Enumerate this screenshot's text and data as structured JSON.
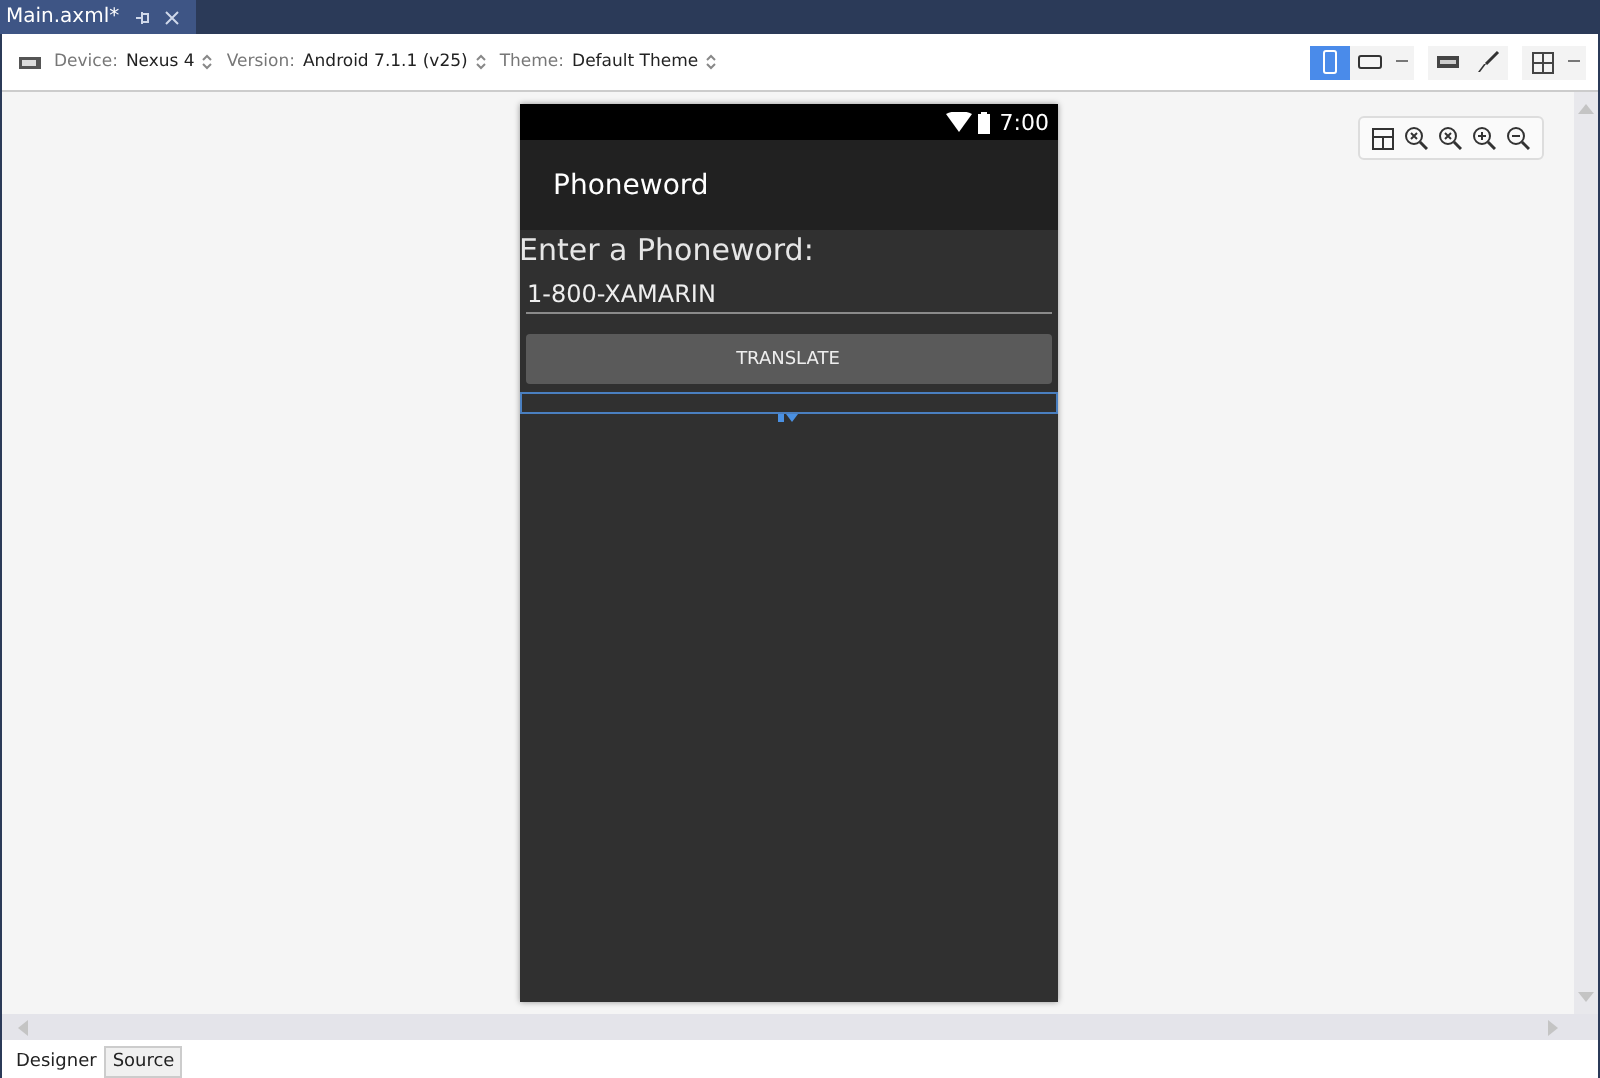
{
  "document_tabs": [
    {
      "label": "Main.axml*",
      "selected": true
    }
  ],
  "toolbar": {
    "fields": [
      {
        "label": "Device:",
        "value": "Nexus 4"
      },
      {
        "label": "Version:",
        "value": "Android 7.1.1 (v25)"
      },
      {
        "label": "Theme:",
        "value": "Default Theme"
      }
    ],
    "orientation": [
      {
        "kind": "portrait",
        "selected": true
      },
      {
        "kind": "landscape",
        "selected": false
      }
    ]
  },
  "phone": {
    "status_time": "7:00",
    "app_title": "Phoneword",
    "prompt": "Enter a Phoneword:",
    "input_value": "1-800-XAMARIN",
    "button": "TRANSLATE"
  },
  "bottom_tabs": [
    {
      "label": "Designer",
      "selected": true
    },
    {
      "label": "Source",
      "selected": false
    }
  ]
}
